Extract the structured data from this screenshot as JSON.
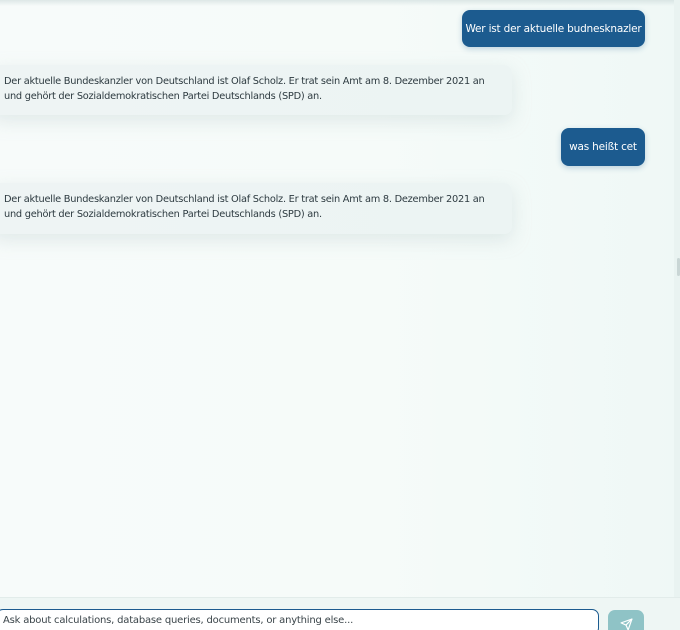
{
  "messages": [
    {
      "role": "user",
      "text": "Wer ist der aktuelle budnesknazler"
    },
    {
      "role": "assistant",
      "text": "Der aktuelle Bundeskanzler von Deutschland ist Olaf Scholz. Er trat sein Amt am 8. Dezember 2021 an und gehört der Sozialdemokratischen Partei Deutschlands (SPD) an."
    },
    {
      "role": "user",
      "text": "was heißt cet"
    },
    {
      "role": "assistant",
      "text": "Der aktuelle Bundeskanzler von Deutschland ist Olaf Scholz. Er trat sein Amt am 8. Dezember 2021 an und gehört der Sozialdemokratischen Partei Deutschlands (SPD) an."
    }
  ],
  "composer": {
    "placeholder": "Ask about calculations, database queries, documents, or anything else...",
    "value": "",
    "send_icon": "send-icon"
  },
  "colors": {
    "user_bubble": "#1c5b8f",
    "assistant_bubble": "#eef4f4",
    "send_button": "#8fc3c6"
  }
}
